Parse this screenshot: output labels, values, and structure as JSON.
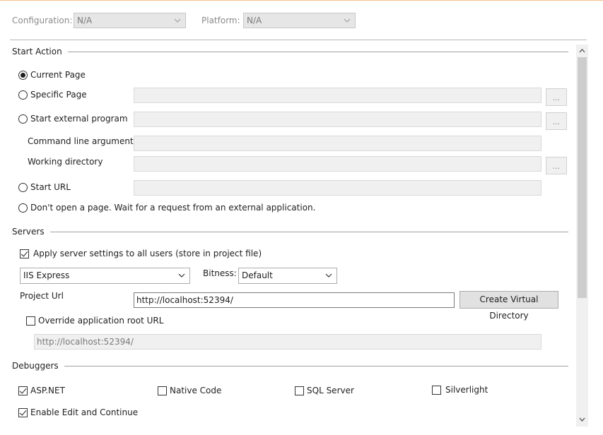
{
  "header": {
    "configuration_label": "Configuration:",
    "configuration_value": "N/A",
    "platform_label": "Platform:",
    "platform_value": "N/A"
  },
  "start_action": {
    "title": "Start Action",
    "current_page": "Current Page",
    "specific_page": "Specific Page",
    "start_external_program": "Start external program",
    "command_line_arguments": "Command line arguments",
    "working_directory": "Working directory",
    "start_url": "Start URL",
    "dont_open": "Don't open a page.  Wait for a request from an external application.",
    "ellipsis": "...",
    "selected": "current_page"
  },
  "servers": {
    "title": "Servers",
    "apply_server_settings": "Apply server settings to all users (store in project file)",
    "apply_checked": true,
    "server_value": "IIS Express",
    "bitness_label": "Bitness:",
    "bitness_value": "Default",
    "project_url_label": "Project Url",
    "project_url_value": "http://localhost:52394/",
    "create_virtual_directory": "Create Virtual Directory",
    "override_root": "Override application root URL",
    "override_checked": false,
    "override_url_value": "http://localhost:52394/"
  },
  "debuggers": {
    "title": "Debuggers",
    "aspnet": "ASP.NET",
    "aspnet_checked": true,
    "native_code": "Native Code",
    "native_checked": false,
    "sql_server": "SQL Server",
    "sql_checked": false,
    "silverlight": "Silverlight",
    "silverlight_checked": false,
    "enable_edit_continue": "Enable Edit and Continue",
    "enable_edit_checked": true
  },
  "icons": {
    "dropdown": "chevron-down-icon",
    "scroll_up": "scroll-up-arrow-icon",
    "scroll_down": "scroll-down-arrow-icon"
  },
  "colors": {
    "accent_top_border": "#f3c08f",
    "disabled_field_bg": "#f0f0f0",
    "button_bg": "#e1e1e1"
  }
}
